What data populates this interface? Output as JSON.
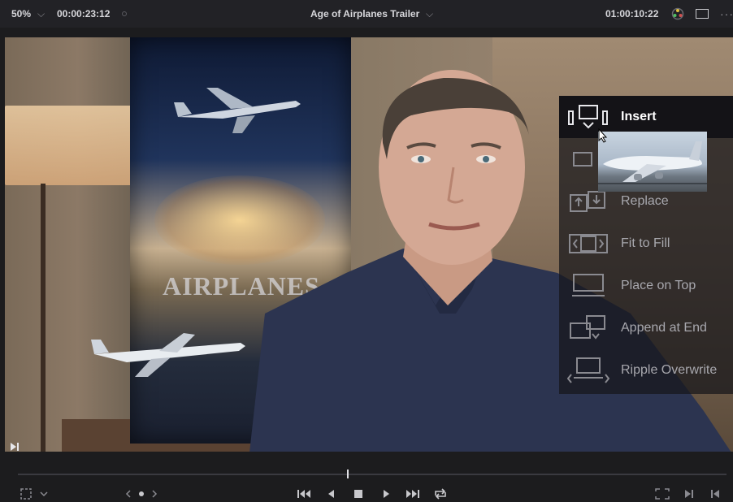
{
  "header": {
    "zoom_level": "50%",
    "zoom_chevron": "⌵",
    "source_timecode": "00:00:23:12",
    "clip_title": "Age of Airplanes Trailer",
    "title_chevron": "⌵",
    "record_timecode": "01:00:10:22",
    "more_glyph": "···"
  },
  "poster": {
    "title": "AIRPLANES"
  },
  "overlay_menu": {
    "items": [
      {
        "label": "Insert",
        "icon": "insert-icon",
        "active": true
      },
      {
        "label": "",
        "icon": "overwrite-icon",
        "active": false
      },
      {
        "label": "Replace",
        "icon": "replace-icon",
        "active": false
      },
      {
        "label": "Fit to Fill",
        "icon": "fit-to-fill-icon",
        "active": false
      },
      {
        "label": "Place on Top",
        "icon": "place-on-top-icon",
        "active": false
      },
      {
        "label": "Append at End",
        "icon": "append-at-end-icon",
        "active": false
      },
      {
        "label": "Ripple Overwrite",
        "icon": "ripple-overwrite-icon",
        "active": false
      }
    ]
  },
  "transport": {
    "playhead_fraction": 0.464,
    "buttons": [
      "crop-icon",
      "jog-control-icon",
      "go-to-start-icon",
      "play-reverse-icon",
      "stop-icon",
      "play-icon",
      "go-to-end-icon",
      "loop-icon",
      "match-frame-icon",
      "next-edit-icon",
      "last-frame-icon"
    ]
  },
  "colors": {
    "background": "#1c1c1e",
    "topbar": "#222226",
    "menu_active_text": "#ffffff",
    "menu_text": "#a8a8ae"
  }
}
